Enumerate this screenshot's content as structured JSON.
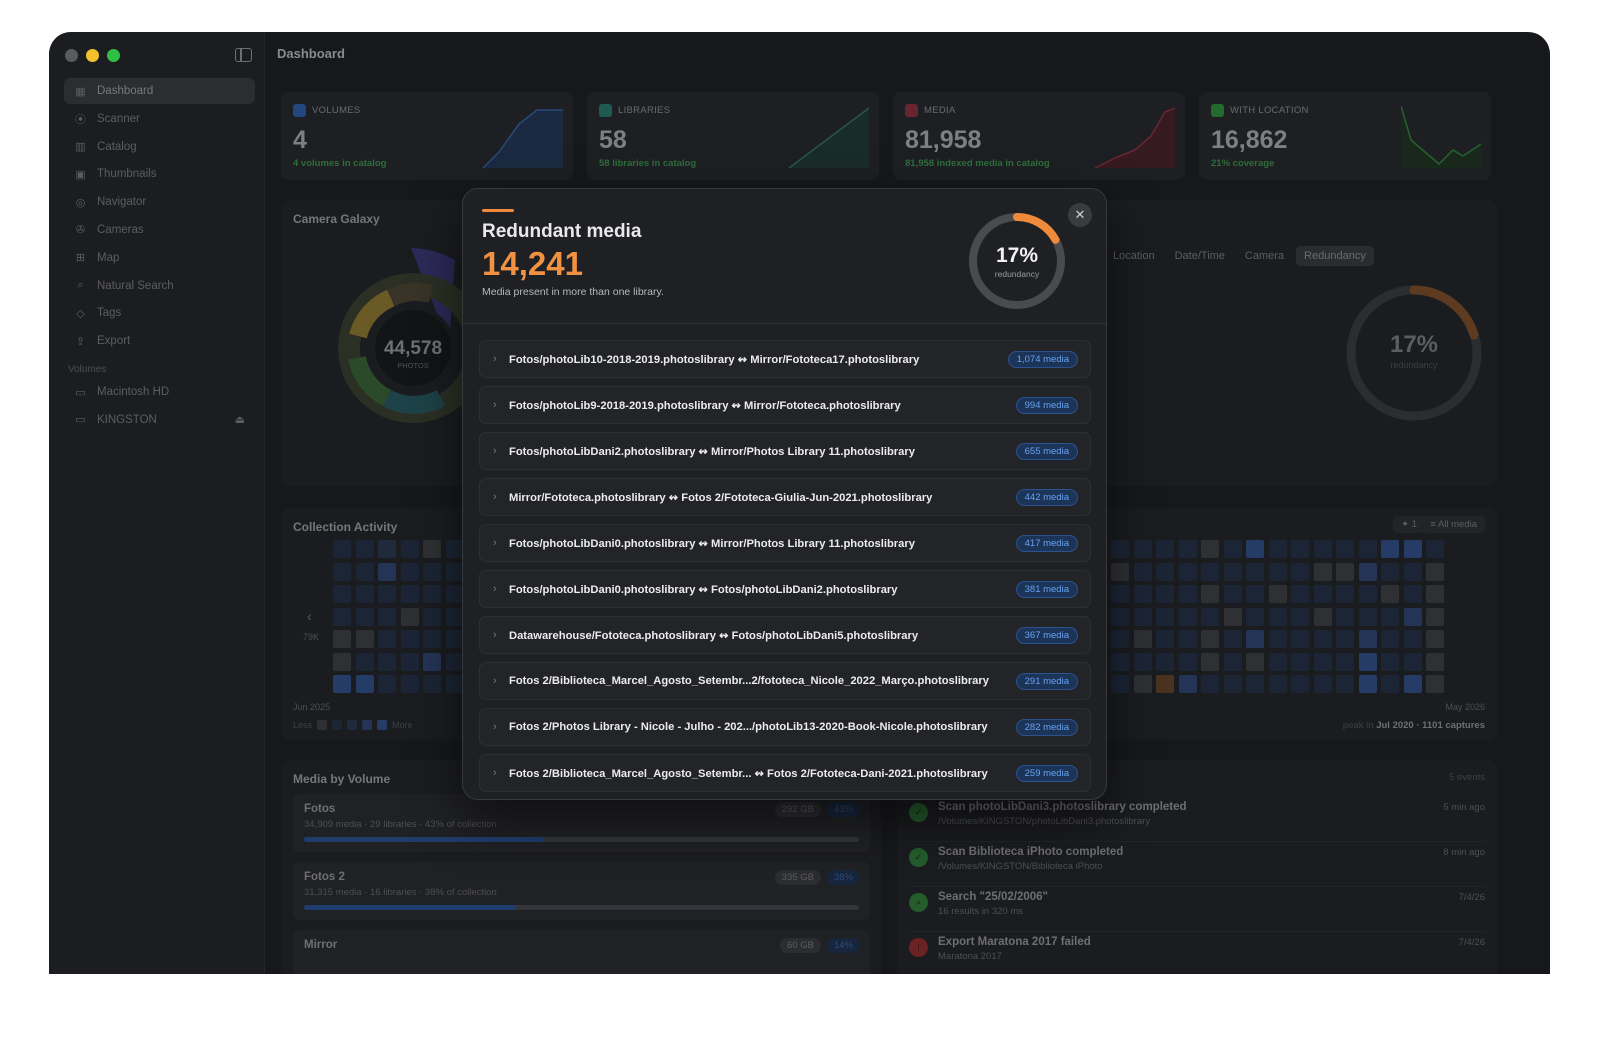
{
  "sidebar": {
    "nav": [
      {
        "label": "Dashboard",
        "icon": "grid-icon"
      },
      {
        "label": "Scanner",
        "icon": "broadcast-icon"
      },
      {
        "label": "Catalog",
        "icon": "books-icon"
      },
      {
        "label": "Thumbnails",
        "icon": "photos-icon"
      },
      {
        "label": "Navigator",
        "icon": "compass-icon"
      },
      {
        "label": "Cameras",
        "icon": "aperture-icon"
      },
      {
        "label": "Map",
        "icon": "map-icon"
      },
      {
        "label": "Natural Search",
        "icon": "search-icon"
      },
      {
        "label": "Tags",
        "icon": "tag-icon"
      },
      {
        "label": "Export",
        "icon": "share-icon"
      }
    ],
    "volumes_heading": "Volumes",
    "volumes": [
      {
        "label": "Macintosh HD",
        "icon": "drive-icon"
      },
      {
        "label": "KINGSTON",
        "icon": "drive-icon"
      }
    ]
  },
  "header": {
    "title": "Dashboard"
  },
  "stats": [
    {
      "label": "VOLUMES",
      "value": "4",
      "sub": "4 volumes in catalog",
      "color": "#2f5fb0"
    },
    {
      "label": "LIBRARIES",
      "value": "58",
      "sub": "58 libraries in catalog",
      "color": "#2a7a6e"
    },
    {
      "label": "MEDIA",
      "value": "81,958",
      "sub": "81,958 indexed media in catalog",
      "color": "#9a2f3a"
    },
    {
      "label": "WITH LOCATION",
      "value": "16,862",
      "sub": "21% coverage",
      "color": "#2f8a3c"
    }
  ],
  "camera_galaxy": {
    "title": "Camera Galaxy",
    "center_value": "44,578",
    "center_label": "PHOTOS",
    "tabs": [
      "Location",
      "Date/Time",
      "Camera",
      "Redundancy"
    ],
    "active_tab": "Redundancy",
    "gauge_value": "17%",
    "gauge_label": "redundancy"
  },
  "activity": {
    "title": "Collection Activity",
    "y_label": "79K",
    "start": "Jun 2025",
    "end": "May 2026",
    "legend_less": "Less",
    "legend_more": "More",
    "pin_count": "1",
    "filter": "All media",
    "peak_prefix": "peak in",
    "peak_value": "Jul 2020 · 1101 captures"
  },
  "media_by_volume": {
    "title": "Media by Volume",
    "items": [
      {
        "name": "Fotos",
        "desc": "34,909 media · 29 libraries · 43% of collection",
        "size": "292 GB",
        "pct": "43%",
        "fill": 0.43
      },
      {
        "name": "Fotos 2",
        "desc": "31,315 media · 16 libraries · 38% of collection",
        "size": "335 GB",
        "pct": "38%",
        "fill": 0.38
      },
      {
        "name": "Mirror",
        "desc": "",
        "size": "60 GB",
        "pct": "14%",
        "fill": 0.14
      }
    ]
  },
  "events": {
    "count": "5 events",
    "items": [
      {
        "title": "Scan photoLibDani3.photoslibrary completed",
        "sub": "/Volumes/KINGSTON/photoLibDani3.photoslibrary",
        "time": "5 min ago",
        "color": "#2f7a3a"
      },
      {
        "title": "Scan Biblioteca iPhoto completed",
        "sub": "/Volumes/KINGSTON/Biblioteca iPhoto",
        "time": "8 min ago",
        "color": "#2f7a3a"
      },
      {
        "title": "Search \"25/02/2006\"",
        "sub": "16 results in 320 ms",
        "time": "7/4/26",
        "color": "#2f7a3a"
      },
      {
        "title": "Export Maratona 2017 failed",
        "sub": "Maratona 2017",
        "time": "7/4/26",
        "color": "#8a2a2a"
      }
    ]
  },
  "modal": {
    "title": "Redundant media",
    "count": "14,241",
    "description": "Media present in more than one library.",
    "gauge_value": "17%",
    "gauge_label": "redundancy",
    "gauge_fraction": 0.17,
    "close_icon": "close-icon",
    "pairs": [
      {
        "a": "Fotos/photoLib10-2018-2019.photoslibrary",
        "b": "Mirror/Fototeca17.photoslibrary",
        "count": "1,074 media"
      },
      {
        "a": "Fotos/photoLib9-2018-2019.photoslibrary",
        "b": "Mirror/Fototeca.photoslibrary",
        "count": "994 media"
      },
      {
        "a": "Fotos/photoLibDani2.photoslibrary",
        "b": "Mirror/Photos Library 11.photoslibrary",
        "count": "655 media"
      },
      {
        "a": "Mirror/Fototeca.photoslibrary",
        "b": "Fotos 2/Fototeca-Giulia-Jun-2021.photoslibrary",
        "count": "442 media"
      },
      {
        "a": "Fotos/photoLibDani0.photoslibrary",
        "b": "Mirror/Photos Library 11.photoslibrary",
        "count": "417 media"
      },
      {
        "a": "Fotos/photoLibDani0.photoslibrary",
        "b": "Fotos/photoLibDani2.photoslibrary",
        "count": "381 media"
      },
      {
        "a": "Datawarehouse/Fototeca.photoslibrary",
        "b": "Fotos/photoLibDani5.photoslibrary",
        "count": "367 media"
      },
      {
        "a": "Fotos 2/Biblioteca_Marcel_Agosto_Setembr...2/fototeca_Nicole_2022_Março.photoslibrary",
        "b": "",
        "count": "291 media"
      },
      {
        "a": "Fotos 2/Photos Library - Nicole - Julho - 202.../photoLib13-2020-Book-Nicole.photoslibrary",
        "b": "",
        "count": "282 media"
      },
      {
        "a": "Fotos 2/Biblioteca_Marcel_Agosto_Setembr...",
        "b": "Fotos 2/Fototeca-Dani-2021.photoslibrary",
        "count": "259 media"
      }
    ]
  }
}
